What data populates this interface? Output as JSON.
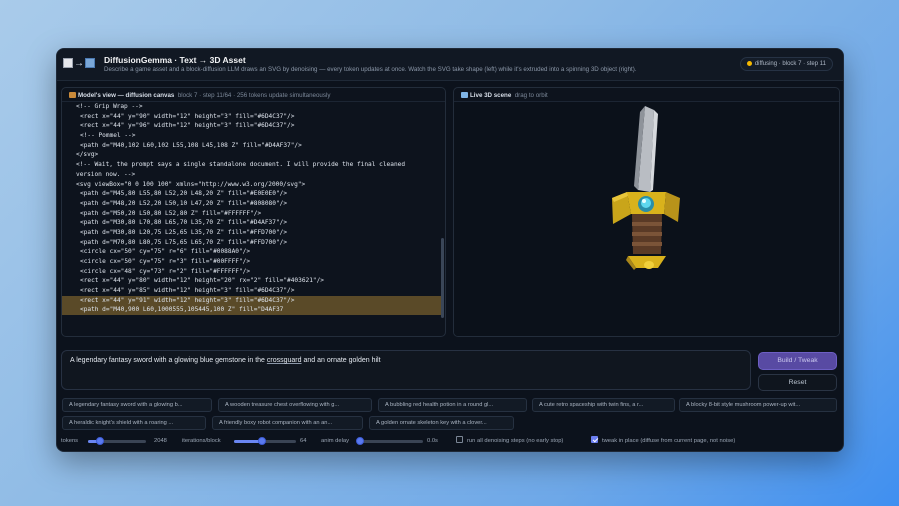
{
  "app": {
    "title": "DiffusionGemma · Text → 3D Asset",
    "subtitle": "Describe a game asset and a block-diffusion LLM draws an SVG by denoising — every token updates at once. Watch the SVG take shape (left) while it's extruded into a spinning 3D object (right).",
    "status": "diffusing · block 7 · step 11",
    "status_color": "#f5b800"
  },
  "left_panel": {
    "title": "Model's view — diffusion canvas",
    "meta": "block 7 · step 11/64 · 256 tokens update simultaneously",
    "code_lines": [
      "<!-- Grip Wrap -->",
      "<rect x=\"44\" y=\"90\" width=\"12\" height=\"3\" fill=\"#6D4C37\"/>",
      "<rect x=\"44\" y=\"96\" width=\"12\" height=\"3\" fill=\"#6D4C37\"/>",
      "<!-- Pommel -->",
      "<path d=\"M40,102 L60,102 L55,108 L45,108 Z\" fill=\"#D4AF37\"/>",
      "</svg>",
      "<!-- Wait, the prompt says a single standalone document. I will provide the final cleaned",
      "version now. -->",
      "<svg viewBox=\"0 0 100 100\" xmlns=\"http://www.w3.org/2000/svg\">",
      "<path d=\"M45,80 L55,80 L52,20 L48,20 Z\" fill=\"#E0E0E0\"/>",
      "<path d=\"M48,20 L52,20 L50,10 L47,20 Z\" fill=\"#808080\"/>",
      "<path d=\"M50,20 L50,80 L52,80 Z\" fill=\"#FFFFFF\"/>",
      "<path d=\"M30,80 L70,80 L65,70 L35,70 Z\" fill=\"#D4AF37\"/>",
      "<path d=\"M30,80 L20,75 L25,65 L35,70 Z\" fill=\"#FFD700\"/>",
      "<path d=\"M70,80 L80,75 L75,65 L65,70 Z\" fill=\"#FFD700\"/>",
      "<circle cx=\"50\" cy=\"75\" r=\"6\" fill=\"#0088A0\"/>",
      "<circle cx=\"50\" cy=\"75\" r=\"3\" fill=\"#00FFFF\"/>",
      "<circle cx=\"48\" cy=\"73\" r=\"2\" fill=\"#FFFFFF\"/>",
      "<rect x=\"44\" y=\"80\" width=\"12\" height=\"20\" rx=\"2\" fill=\"#403621\"/>",
      "<rect x=\"44\" y=\"85\" width=\"12\" height=\"3\" fill=\"#6D4C37\"/>",
      "<rect x=\"44\" y=\"91\" width=\"12\" height=\"3\" fill=\"#6D4C37\"/>",
      "<path d=\"M40,900 L60,1000555,105445,100 Z\" fill=\"D4AF37"
    ],
    "highlight_start": 20,
    "highlight_color": "#5a4a28"
  },
  "right_panel": {
    "title": "Live 3D scene",
    "hint": "drag to orbit"
  },
  "prompt": {
    "pre": "A legendary fantasy sword with a glowing blue gemstone in the ",
    "underlined": "crossguard",
    "post": " and an ornate golden hilt"
  },
  "buttons": {
    "build": "Build / Tweak",
    "reset": "Reset"
  },
  "examples": [
    "A legendary fantasy sword with a glowing b...",
    "A wooden treasure chest overflowing with g...",
    "A bubbling red health potion in a round gl...",
    "A cute retro spaceship with twin fins, a r...",
    "A blocky 8-bit style mushroom power-up wit...",
    "A heraldic knight's shield with a roaring ...",
    "A friendly boxy robot companion with an an...",
    "A golden ornate skeleton key with a clover..."
  ],
  "controls": {
    "tokens_label": "tokens",
    "tokens_value": "2048",
    "tokens_fraction": 0.2,
    "iterations_label": "iterations/block",
    "iterations_value": "64",
    "iterations_fraction": 0.45,
    "anim_label": "anim delay",
    "anim_value": "0.0s",
    "anim_fraction": 0.0,
    "run_all_label": "run all denoising steps (no early stop)",
    "run_all_checked": false,
    "tweak_label": "tweak in place (diffuse from current page, not noise)",
    "tweak_checked": true,
    "accent": "#6a86f2"
  }
}
